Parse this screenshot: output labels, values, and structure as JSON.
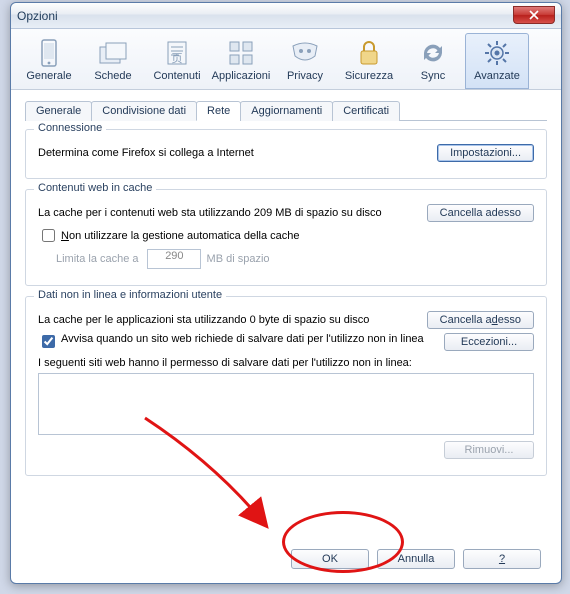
{
  "window": {
    "title": "Opzioni"
  },
  "toolbar": {
    "items": [
      {
        "label": "Generale"
      },
      {
        "label": "Schede"
      },
      {
        "label": "Contenuti"
      },
      {
        "label": "Applicazioni"
      },
      {
        "label": "Privacy"
      },
      {
        "label": "Sicurezza"
      },
      {
        "label": "Sync"
      },
      {
        "label": "Avanzate"
      }
    ],
    "selected": 7
  },
  "subtabs": {
    "items": [
      "Generale",
      "Condivisione dati",
      "Rete",
      "Aggiornamenti",
      "Certificati"
    ],
    "active": 2
  },
  "groups": {
    "connection": {
      "title": "Connessione",
      "desc": "Determina come Firefox si collega a Internet",
      "settings_btn": "Impostazioni..."
    },
    "cache": {
      "title": "Contenuti web in cache",
      "usage": "La cache per i contenuti web sta utilizzando 209 MB di spazio su disco",
      "clear_btn": "Cancella adesso",
      "chk_label_pre": "N",
      "chk_label_rest": "on utilizzare la gestione automatica della cache",
      "limit_label": "Limita la cache a",
      "limit_value": "290",
      "limit_unit": "MB di spazio"
    },
    "offline": {
      "title": "Dati non in linea e informazioni utente",
      "usage": "La cache per le applicazioni sta utilizzando 0 byte di spazio su disco",
      "clear_btn_pre": "Cancella a",
      "clear_btn_u": "d",
      "clear_btn_post": "esso",
      "chk_label": "Avvisa quando un sito web richiede di salvare dati per l'utilizzo non in linea",
      "exceptions_btn": "Eccezioni...",
      "sites_label": "I seguenti siti web hanno il permesso di salvare dati per l'utilizzo non in linea:",
      "remove_btn": "Rimuovi..."
    }
  },
  "footer": {
    "ok": "OK",
    "cancel": "Annulla",
    "help": "?"
  },
  "icons": {
    "generale": "#8aa0ba",
    "schede": "#8aa0ba",
    "contenuti": "#8aa0ba",
    "applicazioni": "#8aa0ba",
    "privacy": "#8aa0ba",
    "sicurezza": "#d9a93a",
    "sync": "#8aa0ba",
    "avanzate": "#5576a8"
  }
}
